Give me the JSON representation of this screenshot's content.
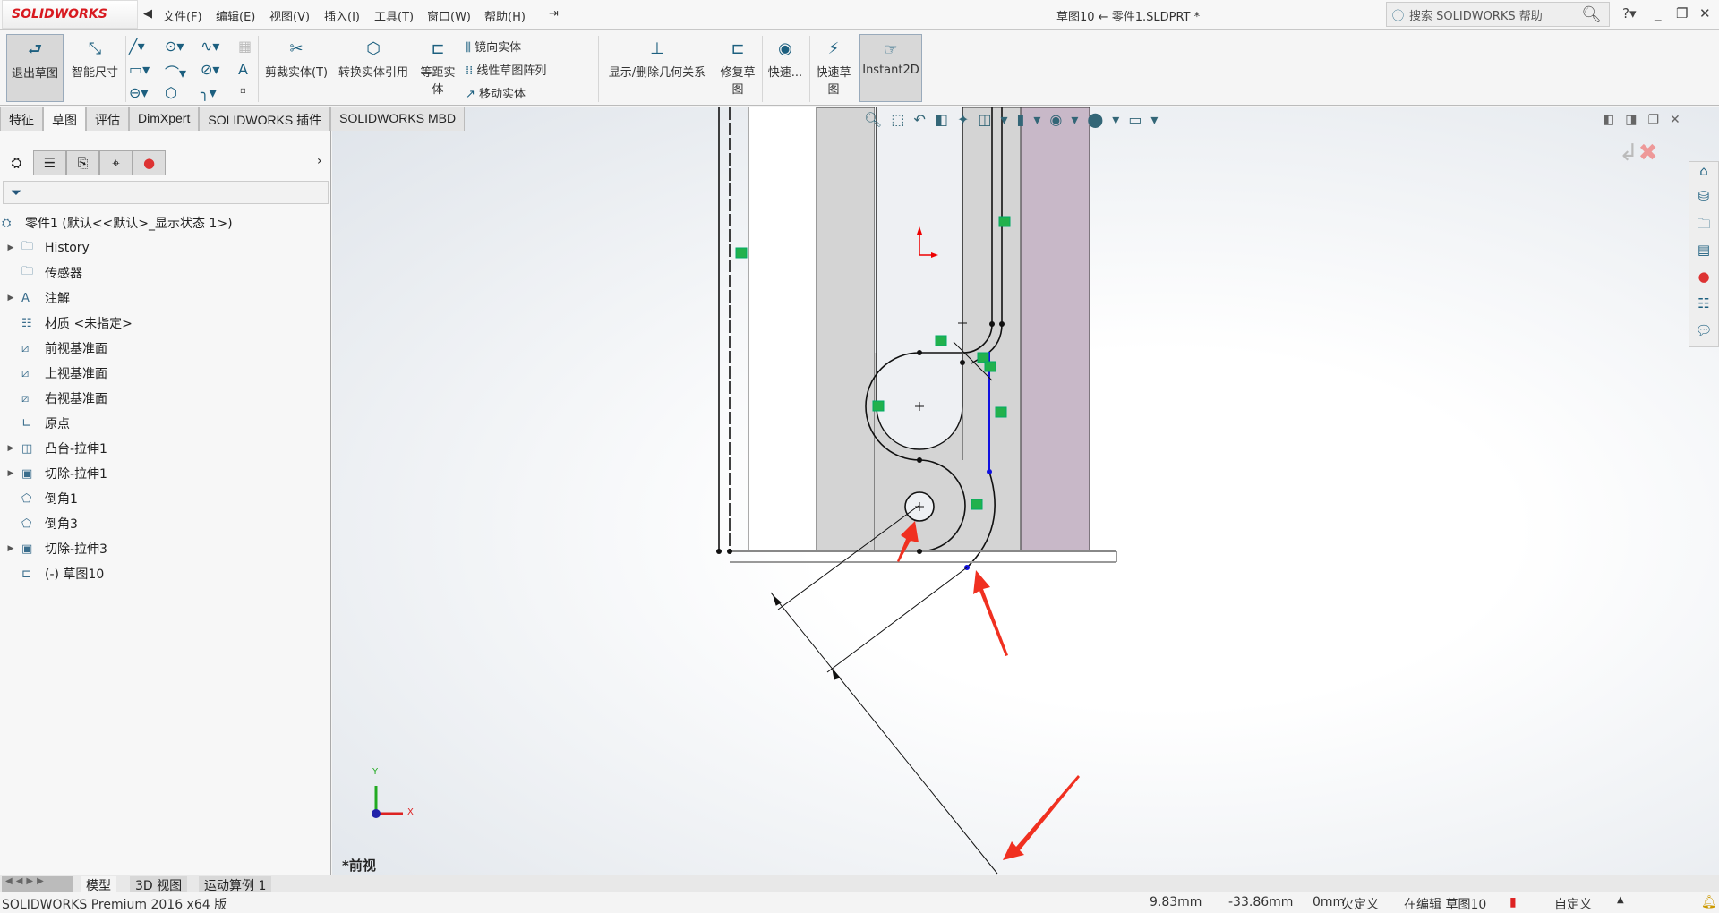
{
  "app": {
    "logo": "SOLIDWORKS",
    "title": "草图10 ← 零件1.SLDPRT *",
    "menu": [
      "文件(F)",
      "编辑(E)",
      "视图(V)",
      "插入(I)",
      "工具(T)",
      "窗口(W)",
      "帮助(H)"
    ],
    "search_placeholder": "搜索 SOLIDWORKS 帮助"
  },
  "commands": {
    "exit_sketch": "退出草图",
    "smart_dim": "智能尺寸",
    "trim": "剪裁实体(T)",
    "convert": "转换实体引用",
    "offset": "等距实体",
    "mirror": "镜向实体",
    "linear_pattern": "线性草图阵列",
    "move": "移动实体",
    "relations": "显示/删除几何关系",
    "repair": "修复草图",
    "quick": "快速...",
    "quick_sketch": "快速草图",
    "instant2d": "Instant2D"
  },
  "tabs": [
    "特征",
    "草图",
    "评估",
    "DimXpert",
    "SOLIDWORKS 插件",
    "SOLIDWORKS MBD"
  ],
  "active_tab": "草图",
  "tree": {
    "root": "零件1  (默认<<默认>_显示状态 1>)",
    "items": [
      {
        "label": "History",
        "icon": "history-folder-icon",
        "expandable": true
      },
      {
        "label": "传感器",
        "icon": "sensor-folder-icon",
        "expandable": false
      },
      {
        "label": "注解",
        "icon": "annotation-folder-icon",
        "expandable": true
      },
      {
        "label": "材质 <未指定>",
        "icon": "material-icon",
        "expandable": false
      },
      {
        "label": "前视基准面",
        "icon": "plane-icon",
        "expandable": false
      },
      {
        "label": "上视基准面",
        "icon": "plane-icon",
        "expandable": false
      },
      {
        "label": "右视基准面",
        "icon": "plane-icon",
        "expandable": false
      },
      {
        "label": "原点",
        "icon": "origin-icon",
        "expandable": false
      },
      {
        "label": "凸台-拉伸1",
        "icon": "boss-extrude-icon",
        "expandable": true
      },
      {
        "label": "切除-拉伸1",
        "icon": "cut-extrude-icon",
        "expandable": true
      },
      {
        "label": "倒角1",
        "icon": "chamfer-icon",
        "expandable": false
      },
      {
        "label": "倒角3",
        "icon": "chamfer-icon",
        "expandable": false
      },
      {
        "label": "切除-拉伸3",
        "icon": "cut-extrude-icon",
        "expandable": true
      },
      {
        "label": "(-) 草图10",
        "icon": "sketch-icon",
        "expandable": false
      }
    ]
  },
  "viewport": {
    "view_name": "*前视",
    "triad": {
      "x": "X",
      "y": "Y"
    }
  },
  "bottom_tabs": [
    "模型",
    "3D 视图",
    "运动算例 1"
  ],
  "status": {
    "product": "SOLIDWORKS Premium 2016 x64 版",
    "x": "9.83mm",
    "y": "-33.86mm",
    "z": "0mm",
    "definition": "欠定义",
    "editing": "在编辑 草图10",
    "units": "自定义"
  },
  "colors": {
    "accent": "#1c5f7f",
    "brand_red": "#d8191f",
    "selected_blue": "#1010e0",
    "relation_green": "#22b14c",
    "purple_face": "#c8b8c8"
  }
}
